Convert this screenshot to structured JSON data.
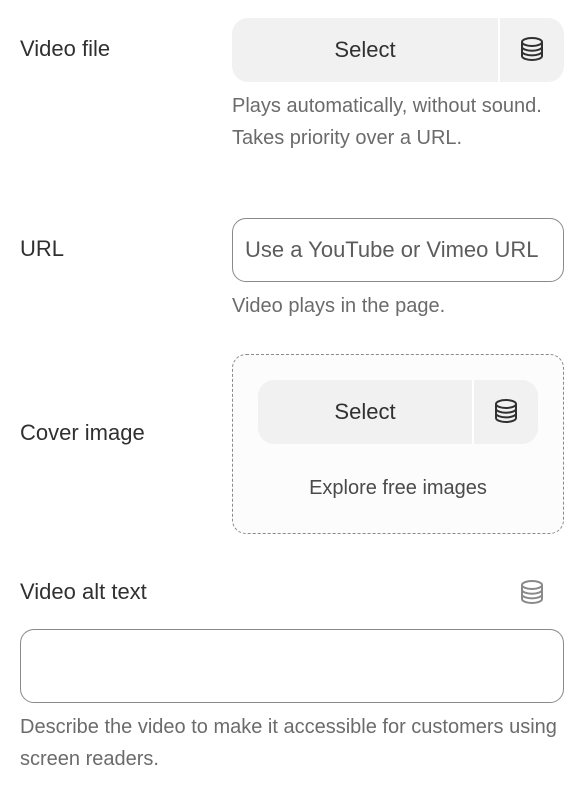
{
  "video_file": {
    "label": "Video file",
    "select_label": "Select",
    "db_icon": "database-icon",
    "help": "Plays automatically, without sound. Takes priority over a URL."
  },
  "url": {
    "label": "URL",
    "placeholder": "Use a YouTube or Vimeo URL",
    "value": "",
    "help": "Video plays in the page."
  },
  "cover_image": {
    "label": "Cover image",
    "select_label": "Select",
    "db_icon": "database-icon",
    "explore_label": "Explore free images"
  },
  "alt_text": {
    "label": "Video alt text",
    "db_icon": "database-icon",
    "value": "",
    "help": "Describe the video to make it accessible for customers using screen readers."
  },
  "colors": {
    "button_bg": "#f1f1f1",
    "border": "#8a8a8a",
    "help_text": "#6b6b6b",
    "text": "#303030"
  }
}
